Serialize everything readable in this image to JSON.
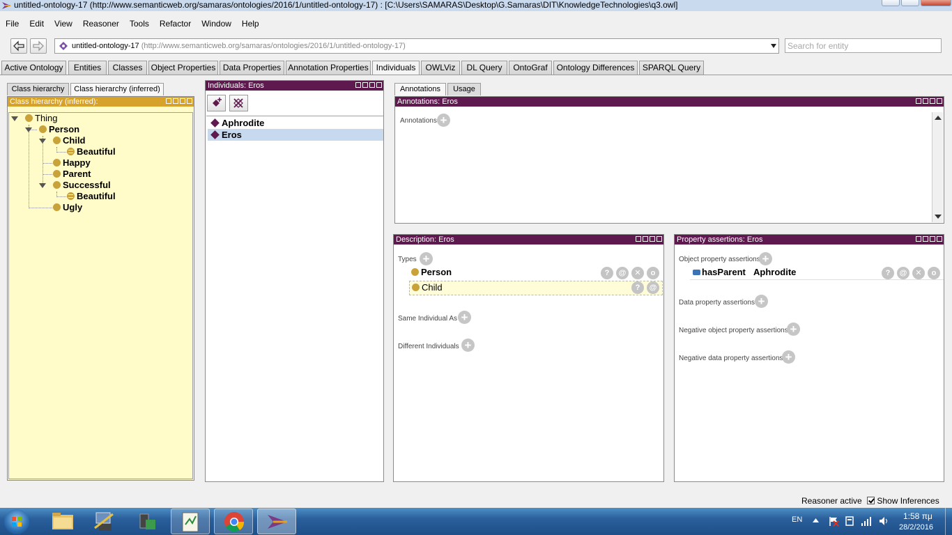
{
  "window": {
    "title": "untitled-ontology-17 (http://www.semanticweb.org/samaras/ontologies/2016/1/untitled-ontology-17)  : [C:\\Users\\SAMARAS\\Desktop\\G.Samaras\\DIT\\KnowledgeTechnologies\\q3.owl]"
  },
  "menu": [
    "File",
    "Edit",
    "View",
    "Reasoner",
    "Tools",
    "Refactor",
    "Window",
    "Help"
  ],
  "toolbar": {
    "ontology_name": "untitled-ontology-17",
    "ontology_uri": "(http://www.semanticweb.org/samaras/ontologies/2016/1/untitled-ontology-17)",
    "search_placeholder": "Search for entity"
  },
  "tabs": [
    {
      "label": "Active Ontology",
      "selected": false
    },
    {
      "label": "Entities",
      "selected": false
    },
    {
      "label": "Classes",
      "selected": false
    },
    {
      "label": "Object Properties",
      "selected": false
    },
    {
      "label": "Data Properties",
      "selected": false
    },
    {
      "label": "Annotation Properties",
      "selected": false
    },
    {
      "label": "Individuals",
      "selected": true
    },
    {
      "label": "OWLViz",
      "selected": false
    },
    {
      "label": "DL Query",
      "selected": false
    },
    {
      "label": "OntoGraf",
      "selected": false
    },
    {
      "label": "Ontology Differences",
      "selected": false
    },
    {
      "label": "SPARQL Query",
      "selected": false
    }
  ],
  "class_panel": {
    "subtabs": [
      "Class hierarchy",
      "Class hierarchy (inferred)"
    ],
    "header": "Class hierarchy (inferred):",
    "tree": [
      "Thing",
      "Person",
      "Child",
      "Beautiful",
      "Happy",
      "Parent",
      "Successful",
      "Beautiful",
      "Ugly"
    ]
  },
  "individuals_panel": {
    "header": "Individuals: Eros",
    "items": [
      "Aphrodite",
      "Eros"
    ],
    "selected": "Eros"
  },
  "annotations_panel": {
    "subtabs": [
      "Annotations",
      "Usage"
    ],
    "header": "Annotations: Eros",
    "annotations_label": "Annotations"
  },
  "description_panel": {
    "header": "Description: Eros",
    "types_label": "Types",
    "types": [
      "Person",
      "Child"
    ],
    "same_label": "Same Individual As",
    "different_label": "Different Individuals"
  },
  "property_panel": {
    "header": "Property assertions: Eros",
    "object_label": "Object property assertions",
    "object_assertion": {
      "property": "hasParent",
      "value": "Aphrodite"
    },
    "data_label": "Data property assertions",
    "neg_object_label": "Negative object property assertions",
    "neg_data_label": "Negative data property assertions"
  },
  "status": {
    "reasoner": "Reasoner active",
    "show_inferences": "Show Inferences"
  },
  "tray": {
    "lang": "EN",
    "time": "1:58 πμ",
    "date": "28/2/2016"
  },
  "colors": {
    "panel_header": "#5e1a4f",
    "hierarchy_header": "#d7a22b",
    "hierarchy_bg": "#fffcc9",
    "class_icon": "#c9a23a",
    "selection": "#c7d9ee"
  }
}
